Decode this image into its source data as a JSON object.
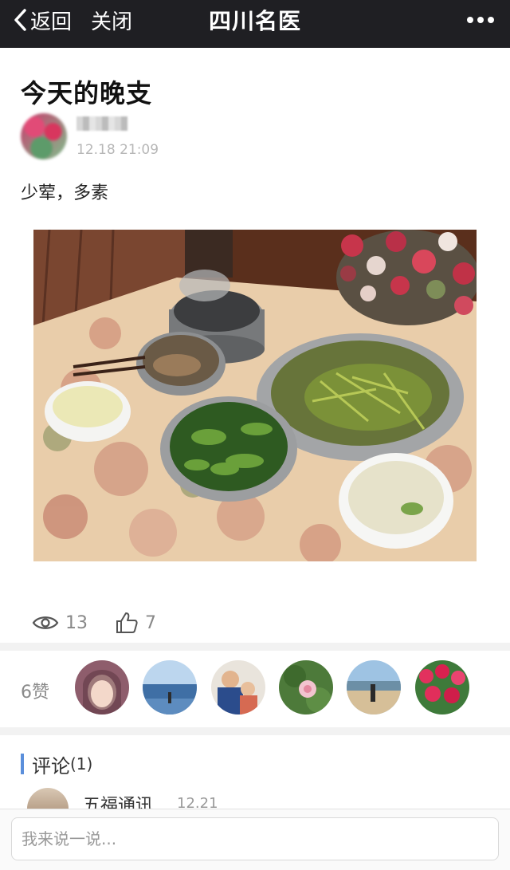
{
  "nav": {
    "back_label": "返回",
    "close_label": "关闭",
    "title": "四川名医"
  },
  "post": {
    "title": "今天的晚支",
    "time": "12.18 21:09",
    "body": "少荤，多素"
  },
  "stats": {
    "views": "13",
    "likes": "7"
  },
  "likers": {
    "label": "6赞"
  },
  "comments": {
    "heading": "评论",
    "count": "(1)",
    "items": [
      {
        "name": "五福通讯",
        "date": "12.21"
      }
    ]
  },
  "footer": {
    "placeholder": "我来说一说..."
  },
  "colors": {
    "topbar": "#1f1f23",
    "accent": "#5b8fdb"
  }
}
